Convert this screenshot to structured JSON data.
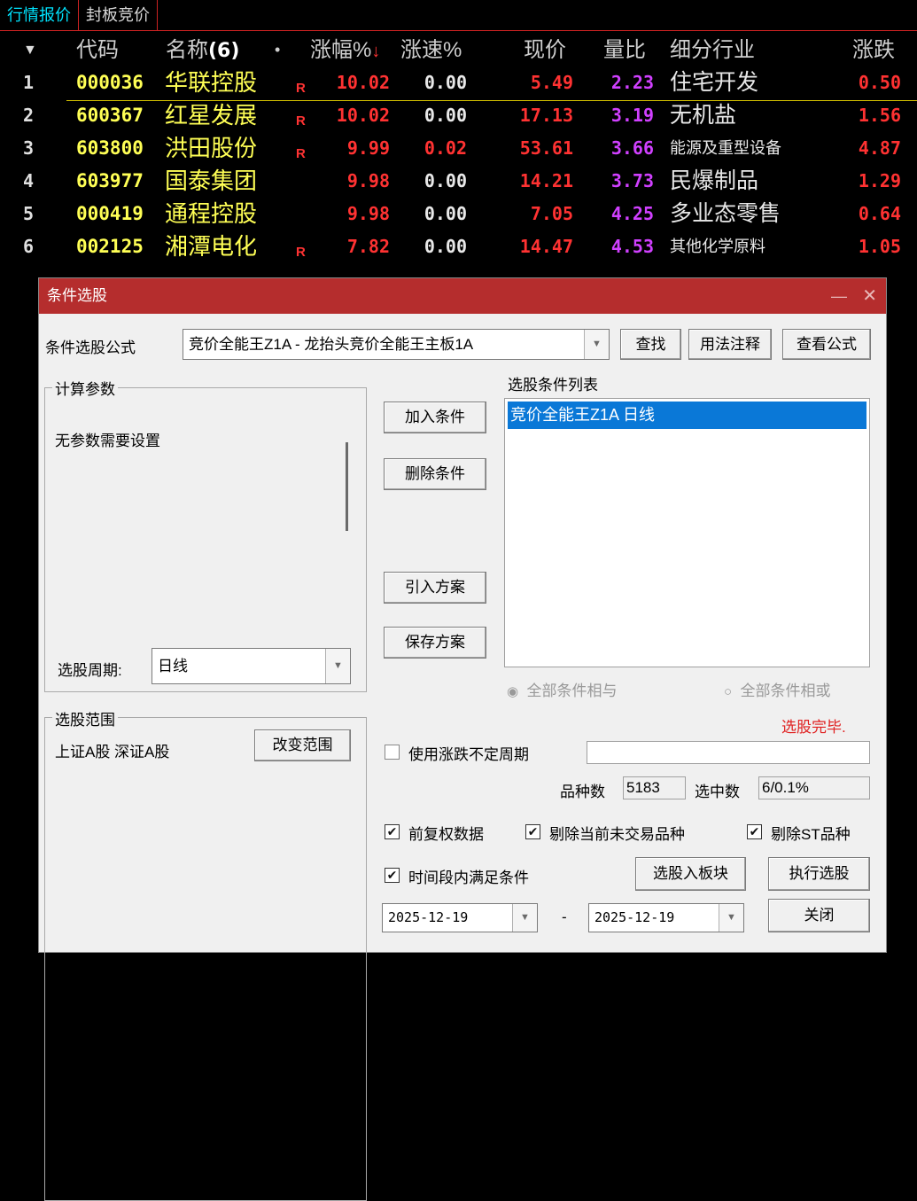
{
  "tabs": [
    {
      "label": "行情报价"
    },
    {
      "label": "封板竞价"
    }
  ],
  "header": {
    "sort_icon": "▼",
    "code": "代码",
    "name": "名称",
    "name_count": "(6)",
    "dot": "•",
    "pct_change": "涨幅%",
    "sort_arrow": "↓",
    "speed": "涨速%",
    "price": "现价",
    "vol_ratio": "量比",
    "industry": "细分行业",
    "change": "涨跌"
  },
  "rows": [
    {
      "idx": "1",
      "code": "000036",
      "name": "华联控股",
      "flag": "R",
      "pct": "10.02",
      "speed": "0.00",
      "price": "5.49",
      "vr": "2.23",
      "industry": "住宅开发",
      "chg": "0.50",
      "speed_red": false,
      "ind_small": false
    },
    {
      "idx": "2",
      "code": "600367",
      "name": "红星发展",
      "flag": "R",
      "pct": "10.02",
      "speed": "0.00",
      "price": "17.13",
      "vr": "3.19",
      "industry": "无机盐",
      "chg": "1.56",
      "speed_red": false,
      "ind_small": false
    },
    {
      "idx": "3",
      "code": "603800",
      "name": "洪田股份",
      "flag": "R",
      "pct": "9.99",
      "speed": "0.02",
      "price": "53.61",
      "vr": "3.66",
      "industry": "能源及重型设备",
      "chg": "4.87",
      "speed_red": true,
      "ind_small": true
    },
    {
      "idx": "4",
      "code": "603977",
      "name": "国泰集团",
      "flag": "",
      "pct": "9.98",
      "speed": "0.00",
      "price": "14.21",
      "vr": "3.73",
      "industry": "民爆制品",
      "chg": "1.29",
      "speed_red": false,
      "ind_small": false
    },
    {
      "idx": "5",
      "code": "000419",
      "name": "通程控股",
      "flag": "",
      "pct": "9.98",
      "speed": "0.00",
      "price": "7.05",
      "vr": "4.25",
      "industry": "多业态零售",
      "chg": "0.64",
      "speed_red": false,
      "ind_small": false
    },
    {
      "idx": "6",
      "code": "002125",
      "name": "湘潭电化",
      "flag": "R",
      "pct": "7.82",
      "speed": "0.00",
      "price": "14.47",
      "vr": "4.53",
      "industry": "其他化学原料",
      "chg": "1.05",
      "speed_red": false,
      "ind_small": true
    }
  ],
  "dialog": {
    "title": "条件选股",
    "minimize": "—",
    "close": "✕",
    "formula_label": "条件选股公式",
    "formula_value": "竞价全能王Z1A  -  龙抬头竞价全能王主板1A",
    "find_btn": "查找",
    "usage_btn": "用法注释",
    "view_btn": "查看公式",
    "params_group": "计算参数",
    "params_text": "无参数需要设置",
    "period_label": "选股周期:",
    "period_value": "日线",
    "add_btn": "加入条件",
    "del_btn": "删除条件",
    "import_btn": "引入方案",
    "save_btn": "保存方案",
    "cond_list_label": "选股条件列表",
    "cond_items": [
      "竞价全能王Z1A  日线"
    ],
    "radio_and": "全部条件相与",
    "radio_or": "全部条件相或",
    "status": "选股完毕.",
    "range_group": "选股范围",
    "range_text": "上证A股 深证A股",
    "range_btn": "改变范围",
    "irregular_label": "使用涨跌不定周期",
    "irregular_value": "",
    "count_label": "品种数",
    "count_value": "5183",
    "selected_label": "选中数",
    "selected_value": "6/0.1%",
    "adj_label": "前复权数据",
    "exclude_label": "剔除当前未交易品种",
    "st_label": "剔除ST品种",
    "timerange_label": "时间段内满足条件",
    "to_block_btn": "选股入板块",
    "exec_btn": "执行选股",
    "close_btn": "关闭",
    "date_from": "2025-12-19",
    "dash": "-",
    "date_to": "2025-12-19",
    "check_mark": "✔"
  }
}
